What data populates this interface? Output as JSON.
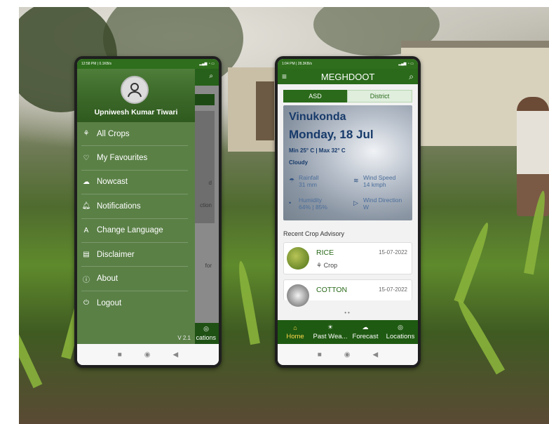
{
  "left_phone": {
    "status": {
      "time": "12:58 PM | 0.1KB/s",
      "icons": "signal wifi battery"
    },
    "user_name": "Upniwesh Kumar Tiwari",
    "menu": [
      {
        "label": "All Crops",
        "icon": "crops-icon"
      },
      {
        "label": "My Favourites",
        "icon": "favourites-icon"
      },
      {
        "label": "Nowcast",
        "icon": "nowcast-icon"
      },
      {
        "label": "Notifications",
        "icon": "bell-icon"
      },
      {
        "label": "Change Language",
        "icon": "language-icon"
      },
      {
        "label": "Disclaimer",
        "icon": "document-icon"
      },
      {
        "label": "About",
        "icon": "info-icon"
      },
      {
        "label": "Logout",
        "icon": "logout-icon"
      }
    ],
    "version": "V 2.1",
    "background_fragments": {
      "f1": "d",
      "f2": "ction",
      "f3": "for",
      "f4": "cations"
    }
  },
  "right_phone": {
    "status": {
      "time": "1:04 PM | 28.3KB/s",
      "icons": "signal wifi battery"
    },
    "app_title": "MEGHDOOT",
    "tabs": {
      "asd": "ASD",
      "district": "District"
    },
    "weather": {
      "city": "Vinukonda",
      "day": "Monday, 18 Jul",
      "minmax": "Min 25° C | Max 32° C",
      "condition": "Cloudy",
      "rainfall_label": "Rainfall",
      "rainfall_value": "31 mm",
      "wind_speed_label": "Wind Speed",
      "wind_speed_value": "14 kmph",
      "humidity_label": "Humidity",
      "humidity_value": "64% | 85%",
      "wind_direction_label": "Wind Direction",
      "wind_direction_value": "W"
    },
    "section_title": "Recent Crop Advisory",
    "advisories": [
      {
        "name": "RICE",
        "date": "15-07-2022",
        "type": "Crop"
      },
      {
        "name": "COTTON",
        "date": "15-07-2022",
        "type": ""
      }
    ],
    "bottom_nav": [
      {
        "label": "Home",
        "icon": "home-icon"
      },
      {
        "label": "Past Wea...",
        "icon": "sun-icon"
      },
      {
        "label": "Forecast",
        "icon": "cloud-icon"
      },
      {
        "label": "Locations",
        "icon": "location-pin-icon"
      }
    ]
  },
  "colors": {
    "brand_green": "#2a6a1a",
    "drawer_green": "#5a8046",
    "active_nav": "#ffd84a"
  }
}
